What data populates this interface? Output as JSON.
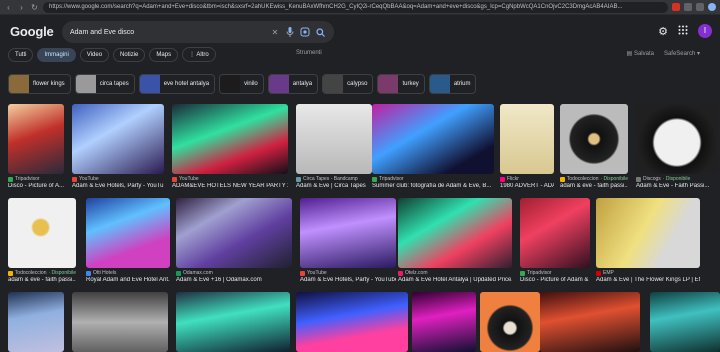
{
  "browser": {
    "url": "https://www.google.com/search?q=Adam+and+Eve+disco&tbm=isch&sxsrf=2ahUKEwiss_KenuBAxWfhmCH2G_CyIQ2i-rCeqQbBAA&oq=Adam+and+eve+disco&gs_lcp=CgNpbWcQA1CnOjvC2C3DmgAcAB4AIAB..."
  },
  "header": {
    "logo": "Google",
    "query": "Adam and Eve disco"
  },
  "tabs": [
    "Tutti",
    "Immagini",
    "Video",
    "Notizie",
    "Maps",
    "Altro"
  ],
  "tools_label": "Strumenti",
  "right_links": {
    "saved": "Salvata",
    "safesearch": "SafeSearch"
  },
  "avatar_letter": "I",
  "chips": [
    {
      "label": "flower kings",
      "color": "#8a6a3a"
    },
    {
      "label": "circa tapes",
      "color": "#9a9a9a"
    },
    {
      "label": "eve hotel antalya",
      "color": "#3a52a8"
    },
    {
      "label": "vinilo",
      "color": "#1c1c1c"
    },
    {
      "label": "antalya",
      "color": "#6a3a8a"
    },
    {
      "label": "calypso",
      "color": "#444444"
    },
    {
      "label": "turkey",
      "color": "#7a3a6a"
    },
    {
      "label": "atrium",
      "color": "#2a5a8a"
    }
  ],
  "results": [
    {
      "source": "Tripadvisor",
      "title": "Disco - Picture of A...",
      "fav": "#34a853",
      "bg": "linear-gradient(160deg,#f2d0a0,#c0302a 45%,#2a2a3a)",
      "available": ""
    },
    {
      "source": "YouTube",
      "title": "Adam & Eve Hotels, Party - YouTu...",
      "fav": "#ea4335",
      "bg": "linear-gradient(150deg,#4060c0,#b0d0ff 40%,#2a1a50)",
      "available": ""
    },
    {
      "source": "YouTube",
      "title": "ADAM&EVE HOTELS NEW YEAR PARTY 20...",
      "fav": "#ea4335",
      "bg": "linear-gradient(160deg,#1a2a3a,#30e0a0 40%,#d02040 70%,#101018)",
      "available": ""
    },
    {
      "source": "Circa Tapes - Bandcamp",
      "title": "Adam & Eve | Circa Tapes",
      "fav": "#629aa9",
      "bg": "linear-gradient(180deg,#e8e8e8,#b8b8b8)",
      "available": ""
    },
    {
      "source": "Tripadvisor",
      "title": "Summer club: fotografía de Adam & Eve, B...",
      "fav": "#34a853",
      "bg": "linear-gradient(150deg,#c020a0,#40a0ff 40%,#101030 80%)",
      "available": ""
    },
    {
      "source": "Flickr",
      "title": "1980 ADVERT - ADA...",
      "fav": "#ff0084",
      "bg": "linear-gradient(180deg,#f0e8c8,#d8c890)",
      "available": ""
    },
    {
      "source": "Todocoleccion",
      "title": "adam & eve - faith passi...",
      "fav": "#f4b400",
      "bg": "radial-gradient(circle at 50% 50%,#e0c080 10%,#111 14%,#222 48%,#bbb 52%)",
      "available": "Disponibile"
    },
    {
      "source": "Discogs",
      "title": "Adam & Eve - Faith Passi...",
      "fav": "#777777",
      "bg": "radial-gradient(circle at 50% 55%,#f0f0f0 40%,#101010 44%,#202020 70%)",
      "available": "Disponibile"
    },
    {
      "source": "Todocoleccion",
      "title": "adam & eve - faith passi...",
      "fav": "#f4b400",
      "bg": "radial-gradient(circle at 48% 42%,#e8c050 14%,#f0f0f0 18%)",
      "available": "Disponibile"
    },
    {
      "source": "Otti Hotels",
      "title": "Royal Adam and Eve Hotel Ant...",
      "fav": "#4285f4",
      "bg": "linear-gradient(160deg,#2040a0,#60c0ff 35%,#d040c0 70%)",
      "available": ""
    },
    {
      "source": "Odamax.com",
      "title": "Adam & Eve +16 | Odamax.com",
      "fav": "#0f9d58",
      "bg": "linear-gradient(150deg,#302040,#a0a0d0 30%,#6040a0 60%,#202030)",
      "available": ""
    },
    {
      "source": "YouTube",
      "title": "Adam & Eve Hotels, Party - YouTube",
      "fav": "#ea4335",
      "bg": "linear-gradient(170deg,#502090,#c090ff 40%,#2a1a60)",
      "available": ""
    },
    {
      "source": "Otelz.com",
      "title": "Adam & Eve Hotel Antalya | Updated Price...",
      "fav": "#e91e63",
      "bg": "linear-gradient(150deg,#104030,#30e0b0 35%,#f04060 65%,#302030)",
      "available": ""
    },
    {
      "source": "Tripadvisor",
      "title": "Disco - Picture of Adam & ...",
      "fav": "#34a853",
      "bg": "linear-gradient(150deg,#a02030,#f04060 40%,#301020)",
      "available": ""
    },
    {
      "source": "EMP",
      "title": "Adam & Eve | The Flower Kings LP | EMP",
      "fav": "#d50000",
      "bg": "linear-gradient(120deg,#c0a040,#f0e080 45%,#d8d8d8 70%)",
      "available": ""
    },
    {
      "source": "",
      "title": "",
      "fav": "#5f6368",
      "bg": "linear-gradient(170deg,#203050,#90b0e0 40%,#c0c0e0)",
      "available": ""
    },
    {
      "source": "",
      "title": "",
      "fav": "#5f6368",
      "bg": "linear-gradient(180deg,#404040,#b0b0b0 50%,#606060)",
      "available": ""
    },
    {
      "source": "",
      "title": "",
      "fav": "#5f6368",
      "bg": "linear-gradient(170deg,#203040,#40e0c0 40%,#102030)",
      "available": ""
    },
    {
      "source": "",
      "title": "",
      "fav": "#5f6368",
      "bg": "linear-gradient(170deg,#101040,#4060ff 40%,#ff40a0 70%)",
      "available": ""
    },
    {
      "source": "",
      "title": "",
      "fav": "#5f6368",
      "bg": "linear-gradient(170deg,#300030,#e020c0 40%,#101030)",
      "available": ""
    },
    {
      "source": "",
      "title": "",
      "fav": "#5f6368",
      "bg": "radial-gradient(circle at 50% 60%,#e8e0d0 12%,#111 16%,#222 46%,#f08040 50%)",
      "available": ""
    },
    {
      "source": "",
      "title": "",
      "fav": "#5f6368",
      "bg": "linear-gradient(170deg,#401010,#e05030 40%,#201010)",
      "available": ""
    },
    {
      "source": "",
      "title": "",
      "fav": "#5f6368",
      "bg": "linear-gradient(170deg,#104040,#40c0c0 40%,#103030)",
      "available": ""
    }
  ]
}
